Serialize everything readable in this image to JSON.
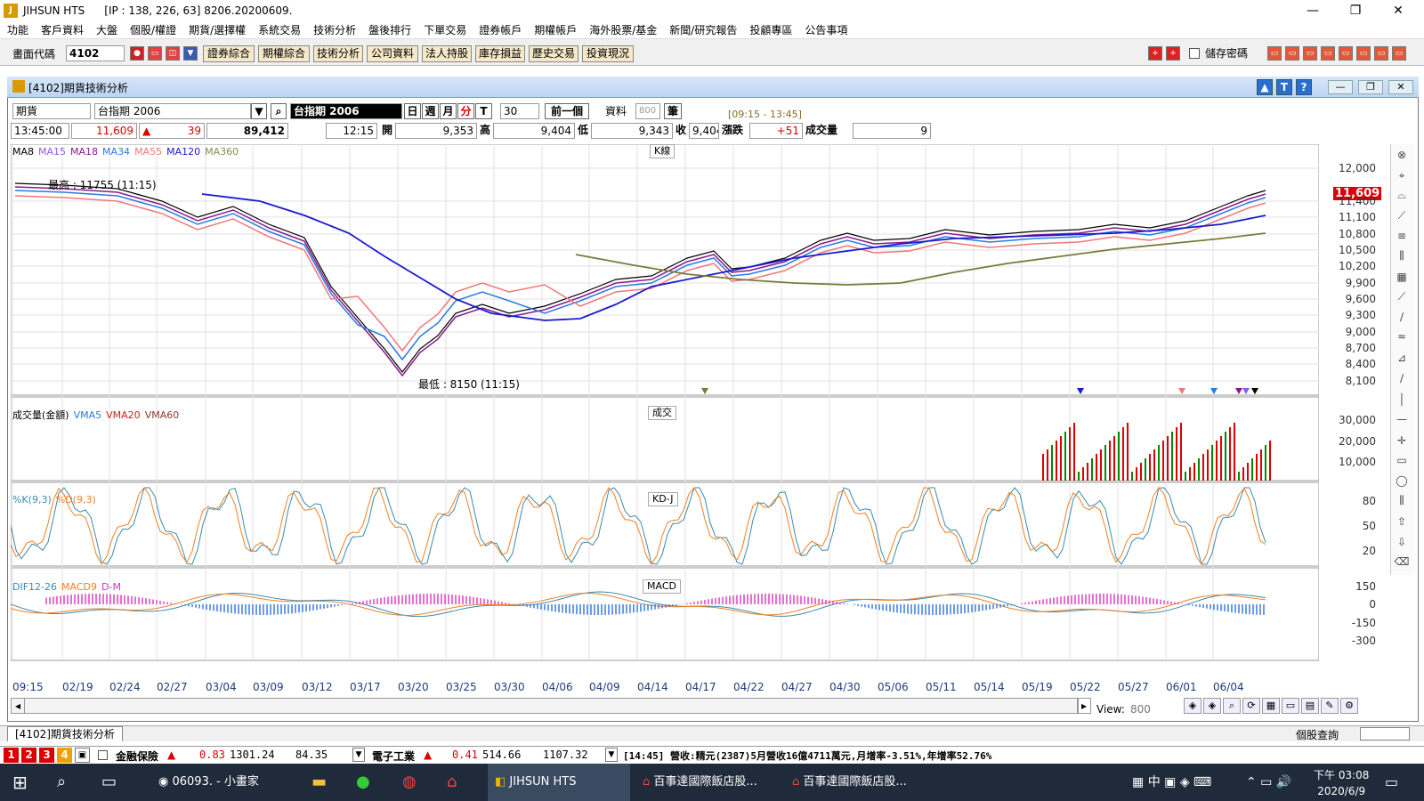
{
  "window": {
    "title": "JIHSUN HTS",
    "subtitle": "[IP : 138, 226, 63] 8206.20200609.",
    "min": "—",
    "max": "❐",
    "close": "✕"
  },
  "menu": [
    "功能",
    "客戶資料",
    "大盤",
    "個股/權證",
    "期貨/選擇權",
    "系統交易",
    "技術分析",
    "盤後排行",
    "下單交易",
    "證券帳戶",
    "期權帳戶",
    "海外股票/基金",
    "新聞/研究報告",
    "投顧專區",
    "公告事項"
  ],
  "toolbar": {
    "code_label": "畫面代碼",
    "code_value": "4102",
    "buttons": [
      "證券綜合",
      "期權綜合",
      "技術分析",
      "公司資料",
      "法人持股",
      "庫存損益",
      "歷史交易",
      "投資現況"
    ],
    "save_pw": "儲存密碼"
  },
  "chartwin": {
    "title": "[4102]期貨技術分析",
    "help_btns": [
      "▲",
      "T",
      "?"
    ]
  },
  "controls": {
    "type": "期貨",
    "symbol": "台指期 2006",
    "symbol_name": "台指期 2006",
    "periods": [
      "日",
      "週",
      "月",
      "分",
      "T"
    ],
    "period_value": "30",
    "prev": "前一個",
    "data_label": "資料",
    "data_count": "800",
    "note_btn": "筆",
    "session": "[09:15 - 13:45]"
  },
  "quote": {
    "time": "13:45:00",
    "price": "11,609",
    "arrow": "▲",
    "change": "39",
    "volume_total": "89,412",
    "bar_time": "12:15",
    "open_label": "開",
    "open": "9,353",
    "high_label": "高",
    "high": "9,404",
    "low_label": "低",
    "low": "9,343",
    "close_label": "收",
    "close": "9,404",
    "chg_label": "漲跌",
    "chg": "+51",
    "vol_label": "成交量",
    "vol": "9"
  },
  "panels": {
    "kline": {
      "tag": "K線",
      "ma_labels": [
        {
          "t": "MA8",
          "c": "#000000"
        },
        {
          "t": "MA15",
          "c": "#8a5cf0"
        },
        {
          "t": "MA18",
          "c": "#8a1a8a"
        },
        {
          "t": "MA34",
          "c": "#2a7adf"
        },
        {
          "t": "MA55",
          "c": "#f07878"
        },
        {
          "t": "MA120",
          "c": "#1a1acf"
        },
        {
          "t": "MA360",
          "c": "#8a8a4a"
        }
      ],
      "high_note": "最高 : 11755 (11:15)",
      "low_note": "最低 : 8150 (11:15)",
      "last_price": "11,609",
      "yticks": [
        "12,000",
        "11,400",
        "11,100",
        "10,800",
        "10,500",
        "10,200",
        "9,900",
        "9,600",
        "9,300",
        "9,000",
        "8,700",
        "8,400",
        "8,100"
      ]
    },
    "volume": {
      "tag": "成交",
      "labels": [
        {
          "t": "成交量(金額)",
          "c": "#000000"
        },
        {
          "t": "VMA5",
          "c": "#2a7adf"
        },
        {
          "t": "VMA20",
          "c": "#d01a1a"
        },
        {
          "t": "VMA60",
          "c": "#8a3a2a"
        }
      ],
      "yticks": [
        "30,000",
        "20,000",
        "10,000"
      ]
    },
    "kd": {
      "tag": "KD-J",
      "labels": [
        {
          "t": "%K(9,3)",
          "c": "#3a8ab0"
        },
        {
          "t": "%D(9,3)",
          "c": "#f08020"
        }
      ],
      "yticks": [
        "80",
        "50",
        "20"
      ]
    },
    "macd": {
      "tag": "MACD",
      "labels": [
        {
          "t": "DIF12-26",
          "c": "#3a8ab0"
        },
        {
          "t": "MACD9",
          "c": "#f08020"
        },
        {
          "t": "D-M",
          "c": "#d030d0"
        }
      ],
      "yticks": [
        "150",
        "0",
        "-150",
        "-300"
      ]
    }
  },
  "xaxis": [
    "09:15",
    "02/19",
    "02/24",
    "02/27",
    "03/04",
    "03/09",
    "03/12",
    "03/17",
    "03/20",
    "03/25",
    "03/30",
    "04/06",
    "04/09",
    "04/14",
    "04/17",
    "04/22",
    "04/27",
    "04/30",
    "05/06",
    "05/11",
    "05/14",
    "05/19",
    "05/22",
    "05/27",
    "06/01",
    "06/04"
  ],
  "bottom": {
    "view_label": "View:",
    "view_value": "800",
    "tab": "[4102]期貨技術分析",
    "stock_query": "個股查詢"
  },
  "ticker": {
    "nums": [
      "1",
      "2",
      "3",
      "4"
    ],
    "item1_name": "金融保險",
    "item1_chg": "0.83",
    "item1_idx": "1301.24",
    "item1_val": "84.35",
    "item2_name": "電子工業",
    "item2_chg": "0.41",
    "item2_idx": "514.66",
    "item2_val": "1107.32",
    "news": "[14:45] 營收:精元(2387)5月營收16億4711萬元,月增率-3.51%,年增率52.76%"
  },
  "taskbar": {
    "app1": "06093. - 小畫家",
    "app2": "JIHSUN HTS",
    "app3": "百事達國際飯店股...",
    "app4": "百事達國際飯店股...",
    "lang": "中",
    "time": "下午 03:08",
    "date": "2020/6/9"
  }
}
